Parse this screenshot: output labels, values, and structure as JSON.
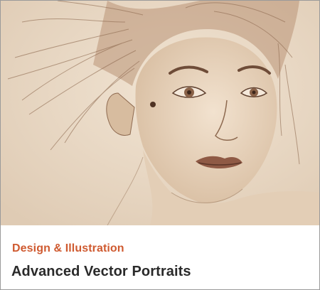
{
  "card": {
    "category": "Design & Illustration",
    "title": "Advanced Vector Portraits",
    "colors": {
      "category_accent": "#cf5a30",
      "title_text": "#2a2a2a",
      "artwork_background": "#eadbc9"
    },
    "artwork_icon": "sepia-portrait-illustration"
  }
}
